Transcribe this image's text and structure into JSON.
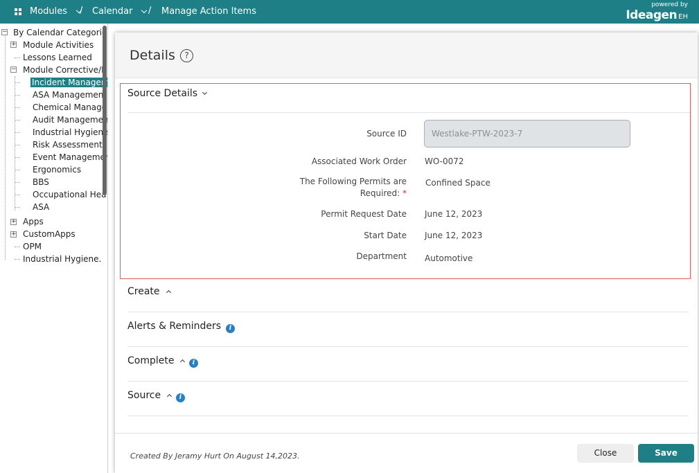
{
  "topbar": {
    "modules_label": "Modules",
    "calendar_label": "Calendar",
    "separator": "/",
    "page_label": "Manage Action Items",
    "powered_by": "powered by",
    "brand": "Ideagen",
    "brand_suffix": "EH"
  },
  "tree": {
    "root": "By Calendar Categories",
    "items": [
      {
        "label": "Module Activities"
      },
      {
        "label": "Lessons Learned"
      },
      {
        "label": "Module Corrective/P"
      },
      {
        "label": "Incident Managem"
      },
      {
        "label": "ASA Management"
      },
      {
        "label": "Chemical Manage"
      },
      {
        "label": "Audit Managemen"
      },
      {
        "label": "Industrial Hygiene"
      },
      {
        "label": "Risk Assessment"
      },
      {
        "label": "Event Managemen"
      },
      {
        "label": "Ergonomics"
      },
      {
        "label": "BBS"
      },
      {
        "label": "Occupational Hea"
      },
      {
        "label": "ASA"
      },
      {
        "label": "Apps"
      },
      {
        "label": "CustomApps"
      },
      {
        "label": "OPM"
      },
      {
        "label": "Industrial Hygiene."
      }
    ],
    "expander_plus": "+",
    "expander_minus": "−"
  },
  "modal": {
    "title": "Details",
    "help_glyph": "?",
    "sections": {
      "source_details": "Source Details",
      "create": "Create",
      "alerts": "Alerts & Reminders",
      "complete": "Complete",
      "source": "Source"
    },
    "info_glyph": "i",
    "fields": {
      "source_id_label": "Source ID",
      "source_id_value": "Westlake-PTW-2023-7",
      "work_order_label": "Associated Work Order",
      "work_order_value": "WO-0072",
      "permits_label_line1": "The Following Permits are",
      "permits_label_line2": "Required:",
      "required_mark": "*",
      "permits_value": "Confined Space",
      "permit_request_label": "Permit Request Date",
      "permit_request_value": "June 12, 2023",
      "start_date_label": "Start Date",
      "start_date_value": "June 12, 2023",
      "department_label": "Department",
      "department_value": "Automotive"
    },
    "footer": {
      "created": "Created By  Jeramy Hurt On August 14,2023.",
      "close_label": "Close",
      "save_label": "Save"
    }
  }
}
